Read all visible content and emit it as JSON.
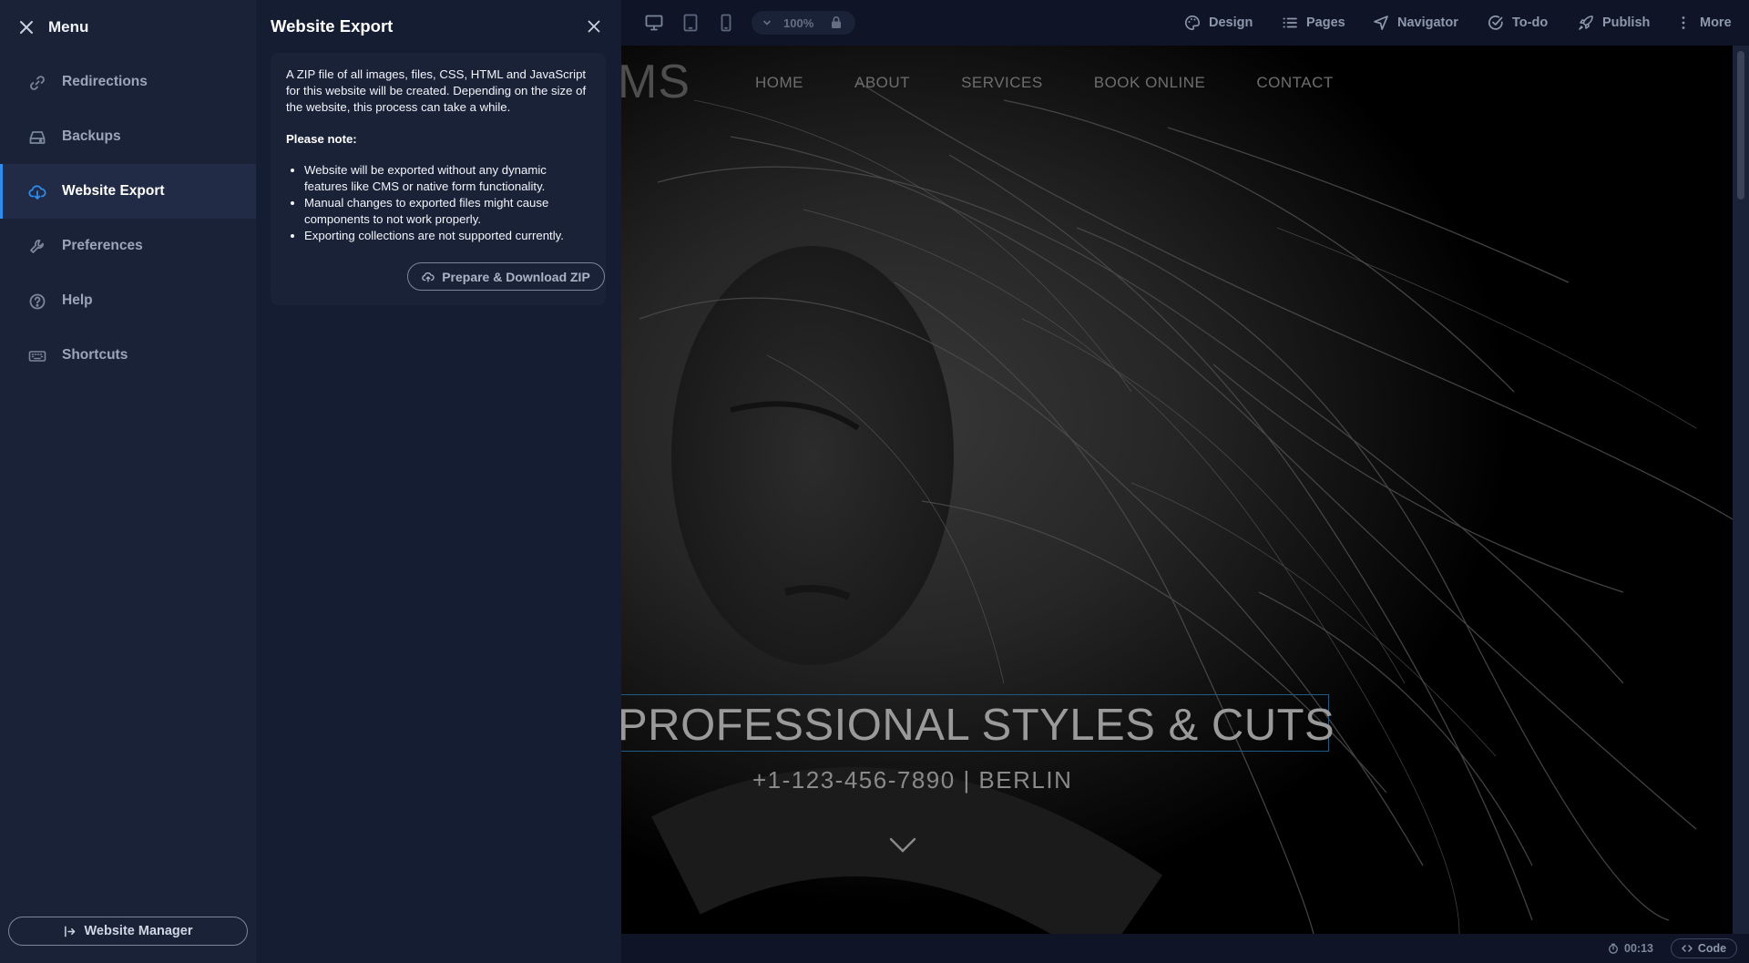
{
  "menu": {
    "title": "Menu",
    "items": [
      {
        "label": "Redirections",
        "icon": "link-icon",
        "active": false
      },
      {
        "label": "Backups",
        "icon": "drive-icon",
        "active": false
      },
      {
        "label": "Website Export",
        "icon": "cloud-download-icon",
        "active": true
      },
      {
        "label": "Preferences",
        "icon": "wrench-icon",
        "active": false
      },
      {
        "label": "Help",
        "icon": "help-circle-icon",
        "active": false
      },
      {
        "label": "Shortcuts",
        "icon": "keyboard-icon",
        "active": false
      }
    ],
    "website_manager_label": "Website Manager"
  },
  "export_panel": {
    "title": "Website Export",
    "description": "A ZIP file of all images, files, CSS, HTML and JavaScript for this website will be created. Depending on the size of the website, this process can take a while.",
    "note_heading": "Please note:",
    "notes": [
      "Website will be exported without any dynamic features like CMS or native form functionality.",
      "Manual changes to exported files might cause components to not work properly.",
      "Exporting collections are not supported currently."
    ],
    "download_label": "Prepare & Download ZIP"
  },
  "toolbar": {
    "zoom": "100%",
    "design_label": "Design",
    "pages_label": "Pages",
    "navigator_label": "Navigator",
    "todo_label": "To-do",
    "publish_label": "Publish",
    "more_label": "More"
  },
  "site": {
    "logo_fragment": "MS",
    "nav": [
      "HOME",
      "ABOUT",
      "SERVICES",
      "BOOK ONLINE",
      "CONTACT"
    ],
    "hero_title": "PROFESSIONAL STYLES & CUTS",
    "hero_subtitle": "+1-123-456-7890 | BERLIN"
  },
  "statusbar": {
    "timer": "00:13",
    "code_label": "Code"
  },
  "colors": {
    "accent": "#2f8cf0",
    "menu_bg": "#1a2238",
    "panel_bg": "#151d33",
    "toolbar_bg": "#0f1526"
  }
}
